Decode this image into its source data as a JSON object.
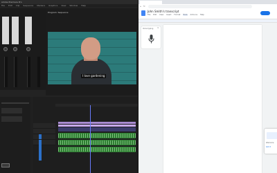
{
  "editor": {
    "window_title": "Adobe Premiere Pro",
    "menu": [
      "File",
      "Edit",
      "Clip",
      "Sequence",
      "Markers",
      "Graphics",
      "View",
      "Window",
      "Help"
    ],
    "program_monitor_title": "Program: Sequence",
    "caption_text": "I love gardening",
    "accent_playhead": "#6a7cff"
  },
  "docs": {
    "doc_title": "John Smith's transcript",
    "menu": [
      "File",
      "Edit",
      "View",
      "Insert",
      "Format",
      "Tools",
      "Add-ons",
      "Help"
    ],
    "voice_typing_label": "Voice typing",
    "toast_text": "Welcome",
    "toast_link": "Got it",
    "brand_color": "#1a73e8"
  }
}
